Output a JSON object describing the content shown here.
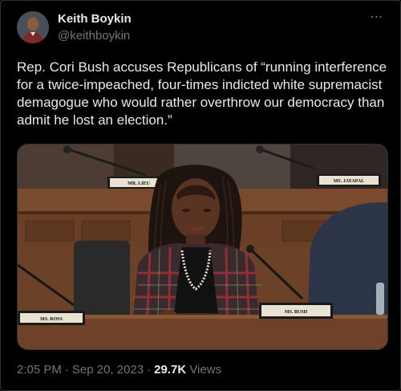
{
  "author": {
    "name": "Keith Boykin",
    "handle": "@keithboykin"
  },
  "tweet": {
    "text": "Rep. Cori Bush accuses Republicans of “running interference for a twice-impeached, four-times indicted white supremacist demagogue who would rather overthrow our democracy than admit he lost an election.”",
    "time": "2:05 PM",
    "date": "Sep 20, 2023",
    "separator": "·",
    "views_count": "29.7K",
    "views_label": "Views"
  },
  "media": {
    "nameplates": {
      "lieu": "MR. LIEU",
      "jayapal": "MS. JAYAPAL",
      "ross": "MS. ROSS",
      "bush": "MS. BUSH"
    }
  },
  "icons": {
    "more": "more-horizontal-icon"
  },
  "colors": {
    "background": "#000000",
    "text_primary": "#e7e9ea",
    "text_secondary": "#71767b",
    "border": "#2f3336"
  }
}
